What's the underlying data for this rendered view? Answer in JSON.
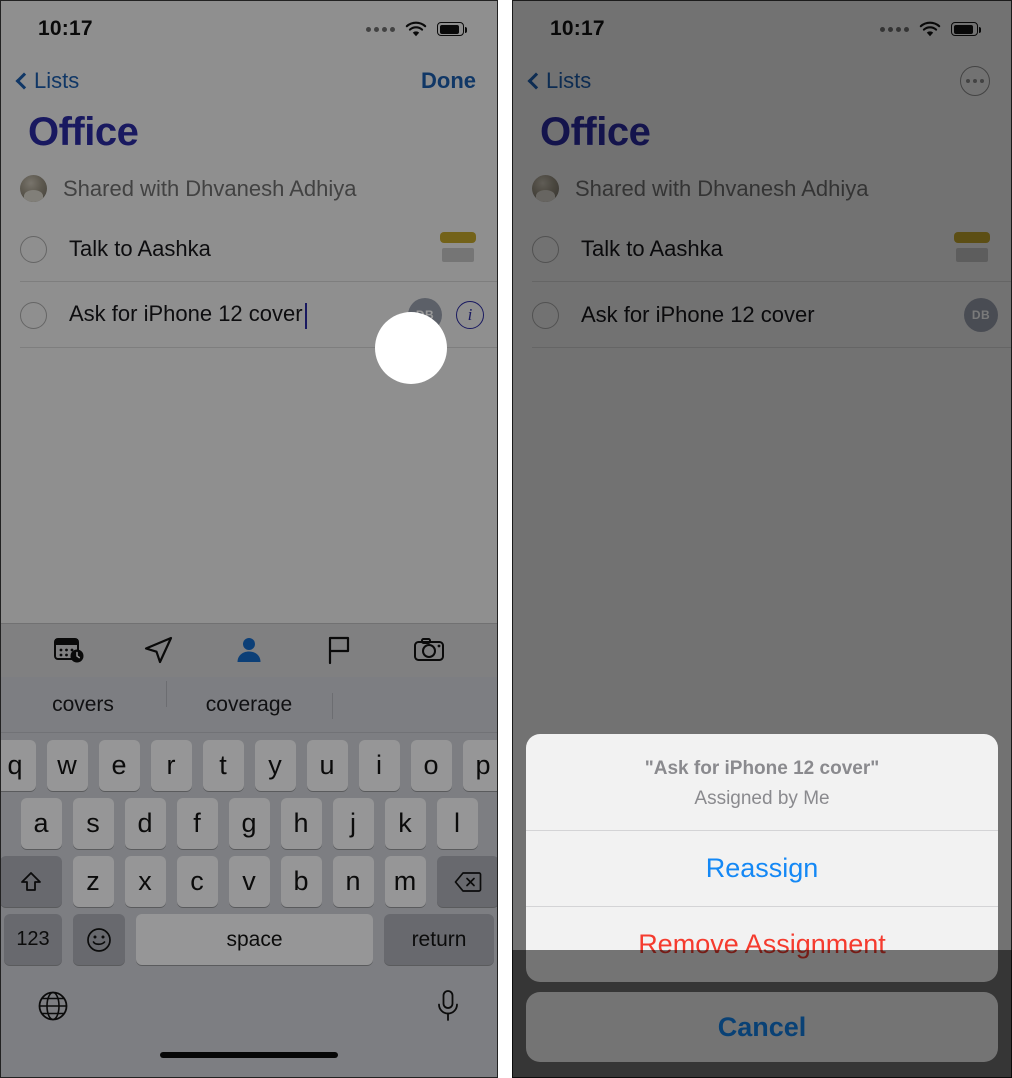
{
  "status_bar": {
    "time": "10:17",
    "signal_icon": "signal-dots-icon",
    "wifi_icon": "wifi-icon",
    "battery_icon": "battery-icon"
  },
  "nav": {
    "back_label": "Lists",
    "back_icon": "chevron-left-icon",
    "done_label": "Done",
    "more_icon": "ellipsis-circle-icon"
  },
  "list": {
    "title": "Office",
    "shared_text": "Shared with Dhvanesh Adhiya",
    "shared_avatar": "contact-photo-avatar"
  },
  "tasks": [
    {
      "title": "Talk to Aashka",
      "checkbox": "incomplete-circle-icon",
      "badge": "flag-chip"
    },
    {
      "title": "Ask for iPhone 12 cover",
      "checkbox": "incomplete-circle-icon",
      "assignee_initials": "DB",
      "info_icon": "info-circle-icon"
    }
  ],
  "edit_toolbar": {
    "items": [
      {
        "name": "calendar-clock-icon",
        "active": false
      },
      {
        "name": "location-arrow-icon",
        "active": false
      },
      {
        "name": "person-icon",
        "active": true
      },
      {
        "name": "flag-icon",
        "active": false
      },
      {
        "name": "camera-icon",
        "active": false
      }
    ]
  },
  "keyboard": {
    "predictions": [
      "covers",
      "coverage",
      ""
    ],
    "row1": [
      "q",
      "w",
      "e",
      "r",
      "t",
      "y",
      "u",
      "i",
      "o",
      "p"
    ],
    "row2": [
      "a",
      "s",
      "d",
      "f",
      "g",
      "h",
      "j",
      "k",
      "l"
    ],
    "row3": [
      "z",
      "x",
      "c",
      "v",
      "b",
      "n",
      "m"
    ],
    "shift_icon": "shift-up-arrow-icon",
    "backspace_icon": "backspace-delete-icon",
    "numbers_label": "123",
    "emoji_icon": "smiley-face-icon",
    "space_label": "space",
    "return_label": "return",
    "globe_icon": "globe-language-icon",
    "mic_icon": "microphone-icon"
  },
  "action_sheet": {
    "title": "\"Ask for iPhone 12 cover\"",
    "subtitle": "Assigned by Me",
    "reassign_label": "Reassign",
    "remove_label": "Remove Assignment",
    "cancel_label": "Cancel"
  },
  "colors": {
    "tint_blue": "#1488f5",
    "nav_blue": "#1c5dab",
    "title_indigo": "#2b2ba0",
    "destructive_red": "#f53b2e",
    "flag_yellow": "#c0a32a",
    "avatar_gray": "#9aa0ae"
  },
  "tap_indicator": {
    "name": "tap-highlight-ring"
  }
}
